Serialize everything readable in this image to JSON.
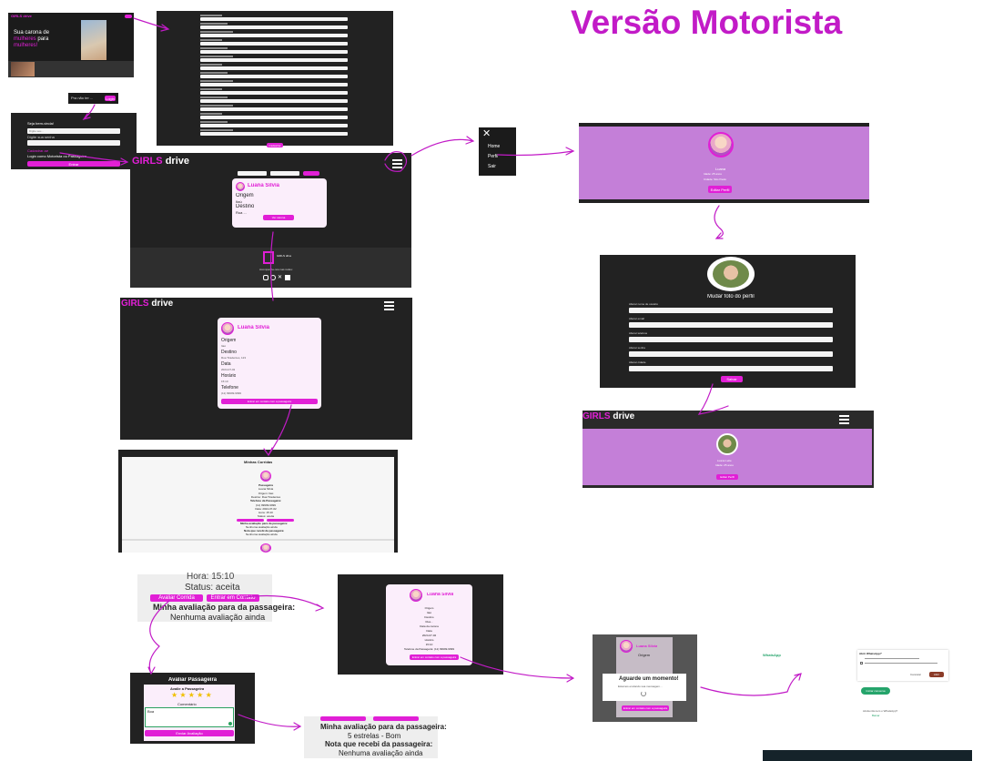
{
  "title": "Versão Motorista",
  "colors": {
    "brand": "#e11fd6",
    "dark": "#222222",
    "purple": "#c47fd8",
    "card": "#fbeefb",
    "arrow": "#c21bc7"
  },
  "landing": {
    "logo": "GIRLS drive",
    "headline_1": "Sua carona de",
    "headline_2": "mulheres",
    "headline_3": "para",
    "headline_4": "mulheres!"
  },
  "login_bar": {
    "prompt": "Pra não ter ...",
    "button": "Login"
  },
  "login": {
    "heading": "Seja bem-vinda!",
    "email_label": "Email",
    "email_value": "Digite seu...",
    "password_label": "Digite sua senha",
    "link": "Cadastrar-se",
    "passenger_line": "Login como Motorista ou Passageira",
    "button": "Entrar"
  },
  "register_button": "Cadastrar",
  "app": {
    "girls": "GIRLS",
    "drive": "drive"
  },
  "ride_card": {
    "name": "Luana Silvia",
    "origem_label": "Origem",
    "origem_value": "Itaú",
    "destino_label": "Destino",
    "destino_value": "Rua ...",
    "button": "Ver carona"
  },
  "footer": {
    "brand": "GIRLS drive",
    "text": "Acompanhe-nos nas redes:"
  },
  "menu": {
    "items": [
      "Home",
      "Perfil",
      "Sair"
    ]
  },
  "profile": {
    "name": "Luana",
    "line1": "Idade: 25 anos",
    "line2": "Cidade: São Paulo",
    "button": "Editar Perfil"
  },
  "edit_profile": {
    "title": "Mudar foto do perfil",
    "fields": [
      "Alterar nome de usuário",
      "Alterar email",
      "Alterar telefone",
      "Alterar senha",
      "Alterar cidade"
    ],
    "button": "Salvar"
  },
  "profile2": {
    "name": "Luana Leite",
    "line1": "Idade: 25 anos",
    "button": "Editar Perfil"
  },
  "ride_detail": {
    "name": "Luana Silvia",
    "labels": [
      "Origem",
      "Destino",
      "Data",
      "Horário",
      "Telefone"
    ],
    "values": [
      "Itaú",
      "Rua Tiradentes, 123",
      "2024-07-02",
      "15:10",
      "(11) 99999-9999"
    ],
    "button": "Entrar em contato com a passageira"
  },
  "history": {
    "header": "Minhas Corridas",
    "lines": [
      "Passageira",
      "Luana Silvia",
      "Origem: Itaú",
      "Destino: Rua Tiradentes",
      "Telefone da Passageira:",
      "(11) 99999-9999",
      "Data: 2024-07-02",
      "Hora: 15:10",
      "Status: aceita"
    ],
    "rating_title": "Minha avaliação para da passageira:",
    "rating_value": "Nenhuma avaliação ainda",
    "received_title": "Nota que recebi da passageira:",
    "received_value": "Nenhuma avaliação ainda"
  },
  "zoom": {
    "hora": "Hora: 15:10",
    "status": "Status: aceita",
    "btn_rate": "Avaliar Corrida",
    "btn_contact": "Entrar em Contato",
    "rating_title": "Minha avaliação para da passageira:",
    "rating_value": "Nenhuma avaliação ainda"
  },
  "rate_dialog": {
    "title": "Avaliar Passageira",
    "subtitle": "Avalie a Passageira",
    "stars": "★ ★ ★ ★ ★",
    "comment_label": "Comentário",
    "comment_value": "Boa",
    "button": "Enviar Avaliação"
  },
  "result": {
    "title": "Minha avaliação para da passageira:",
    "value": "5 estrelas - Bom",
    "received_title": "Nota que recebi da passageira:",
    "received_value": "Nenhuma avaliação ainda"
  },
  "contact_card": {
    "name": "Luana Silvia",
    "lines": [
      "Origem",
      "Itaú",
      "Destino",
      "Rua...",
      "Data da carona",
      "Data",
      "2024-07-02",
      "Horário",
      "15:10",
      "Telefone da Passageira: (11) 99999-9999"
    ],
    "button": "Entrar em contato com a passageira"
  },
  "waiting": {
    "name": "Luana Silvia",
    "origem": "Origem",
    "title": "Aguarde um momento!",
    "subtitle": "Estamos enviando sua mensagem...",
    "button": "Entrar em contato com a passageira"
  },
  "whatsapp": {
    "brand": "WhatsApp",
    "dialog_title": "Abrir WhatsApp?",
    "button_cancel": "Cancelar",
    "button_open": "Abrir",
    "cta": "Iniciar conversa",
    "footer": "Ainda não tem o WhatsApp?",
    "link": "Baixar"
  }
}
